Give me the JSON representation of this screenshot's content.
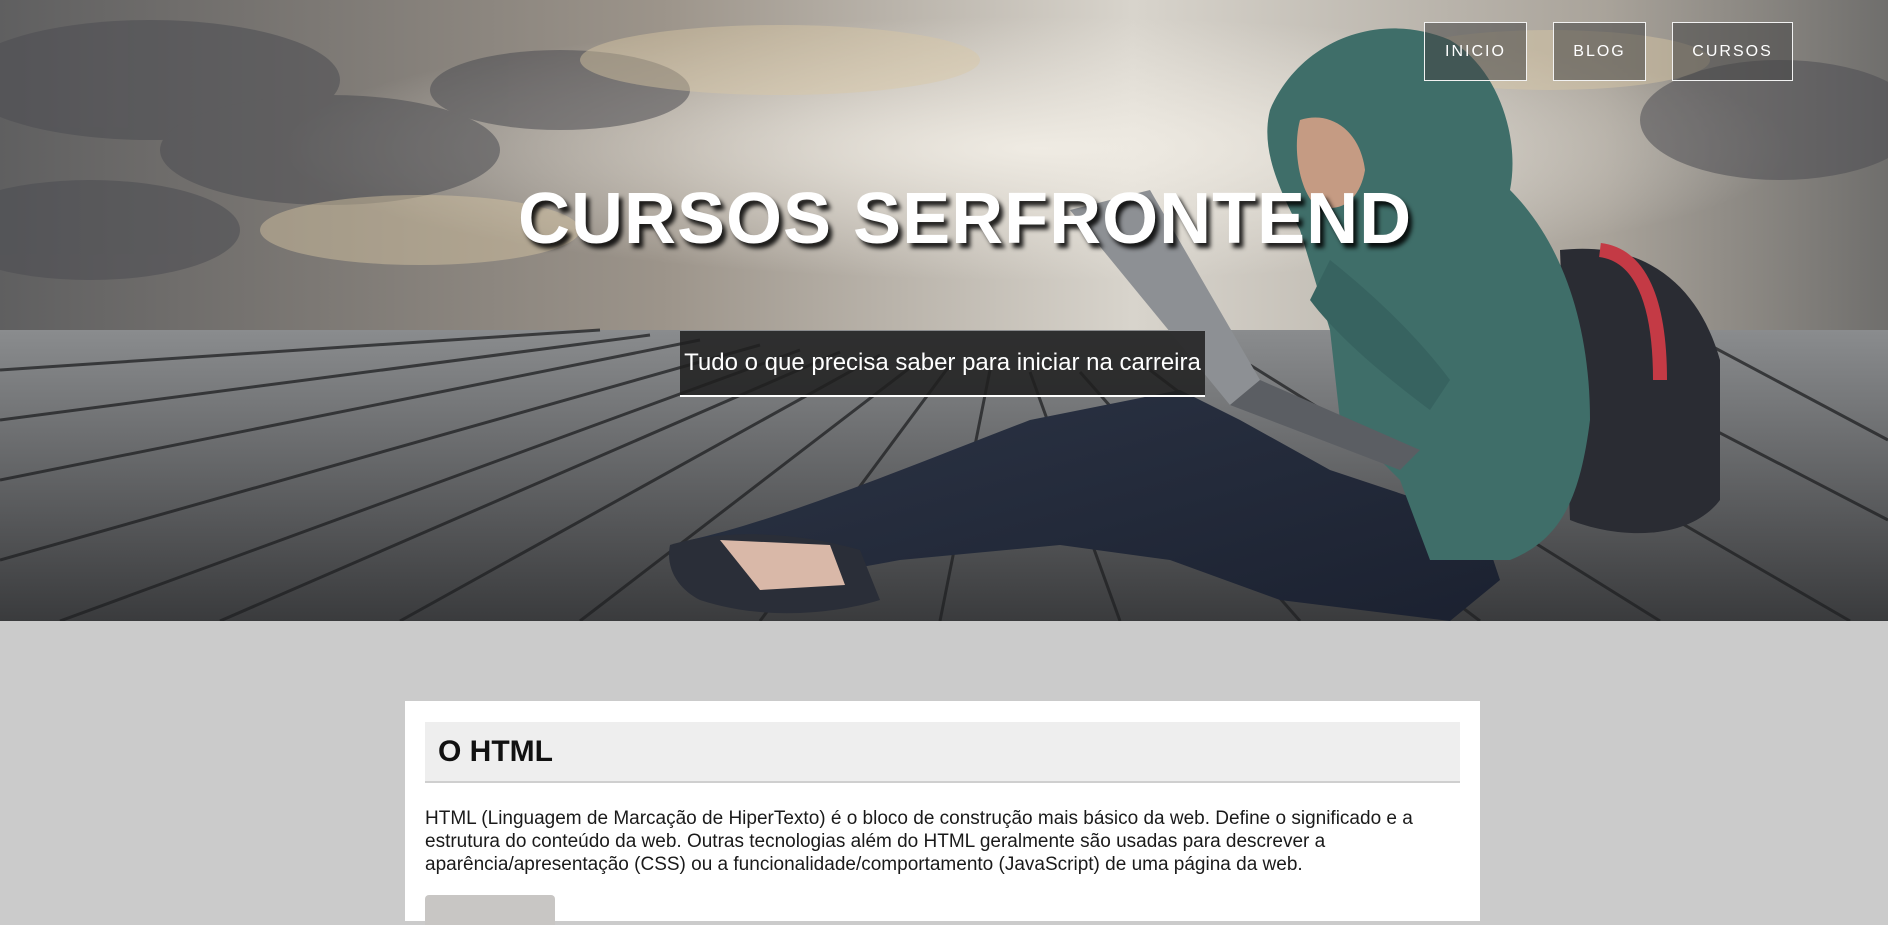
{
  "nav": {
    "items": [
      {
        "label": "INICIO"
      },
      {
        "label": "BLOG"
      },
      {
        "label": "CURSOS"
      }
    ]
  },
  "hero": {
    "title": "CURSOS SERFRONTEND",
    "subtitle": "Tudo o que precisa saber para iniciar na carreira"
  },
  "section": {
    "title": "O HTML",
    "body": "HTML (Linguagem de Marcação de HiperTexto) é o bloco de construção mais básico da web. Define o significado e a estrutura do conteúdo da web. Outras tecnologias além do HTML geralmente são usadas para descrever a aparência/apresentação (CSS) ou a funcionalidade/comportamento (JavaScript) de uma página da web."
  },
  "colors": {
    "page_background": "#cbcbcb",
    "card_background": "#ffffff",
    "card_header_background": "#eeeeee",
    "hoodie": "#3f6e69",
    "backpack_strap": "#c43a45"
  }
}
